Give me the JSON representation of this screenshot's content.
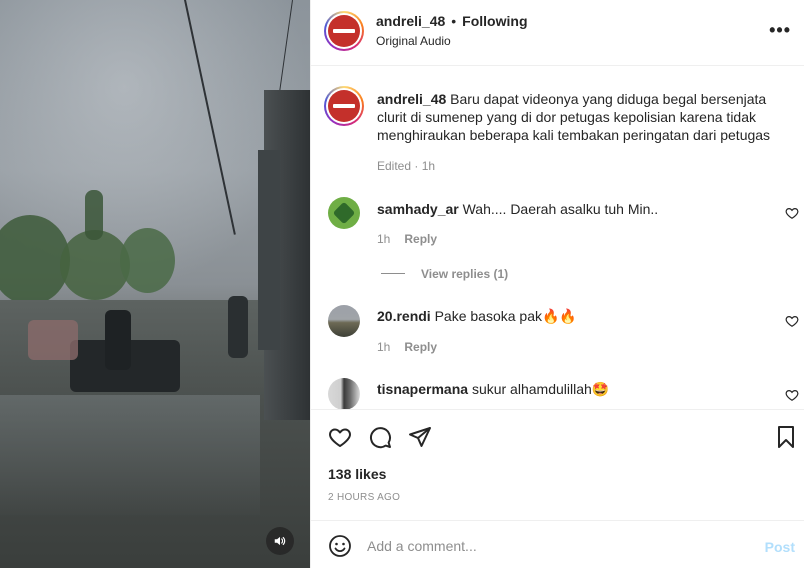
{
  "header": {
    "username": "andreli_48",
    "separator": "•",
    "follow_status": "Following",
    "audio": "Original Audio",
    "more_label": "•••"
  },
  "caption": {
    "username": "andreli_48",
    "text": "Baru dapat videonya yang diduga begal bersenjata clurit di sumenep yang di dor petugas kepolisian karena tidak menghiraukan beberapa kali tembakan peringatan dari petugas",
    "meta": "Edited · 1h"
  },
  "comments": [
    {
      "username": "samhady_ar",
      "text": "Wah.... Daerah asalku tuh Min..",
      "time": "1h",
      "reply": "Reply",
      "view_replies": "View replies (1)"
    },
    {
      "username": "20.rendi",
      "text": "Pake basoka pak🔥🔥",
      "time": "1h",
      "reply": "Reply"
    },
    {
      "username": "tisnapermana",
      "text": "sukur alhamdulillah🤩"
    }
  ],
  "actions": {
    "like_icon": "heart-icon",
    "comment_icon": "comment-bubble-icon",
    "share_icon": "paper-plane-icon",
    "save_icon": "bookmark-icon"
  },
  "likes": "138 likes",
  "posted_ago": "2 HOURS AGO",
  "add_comment": {
    "placeholder": "Add a comment...",
    "post_label": "Post",
    "emoji_icon": "emoji-smile-icon"
  },
  "colors": {
    "text": "#262626",
    "secondary": "#8e8e8e",
    "post_disabled": "#b2dffc",
    "divider": "#efefef"
  }
}
